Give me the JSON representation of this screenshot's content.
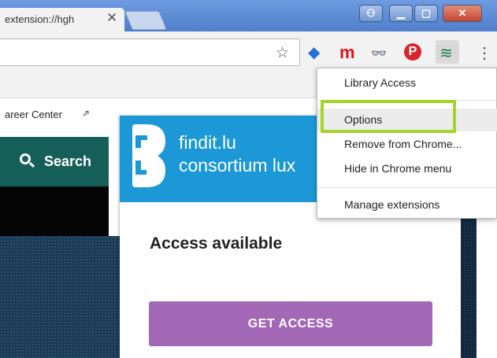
{
  "tab": {
    "title": "extension://hgh",
    "close": "✕"
  },
  "window_buttons": {
    "user": "⚇",
    "minimize": "▁",
    "maximize": "▢",
    "close": "✕"
  },
  "toolbar": {
    "star": "☆",
    "extensions": {
      "diamond": "◆",
      "m": "m",
      "mask": "👓",
      "pin": "P",
      "layers": "≋"
    },
    "menu": "⋮"
  },
  "page": {
    "career_link": "areer Center",
    "career_ext_icon": "⇗",
    "search_label": "Search"
  },
  "popup": {
    "brand_line1": "findit.lu",
    "brand_line2": "consortium lux",
    "access_heading": "Access available",
    "get_access_button": "GET ACCESS",
    "header_color": "#1c98d6",
    "button_color": "#a267b5"
  },
  "context_menu": {
    "items": [
      "Library Access",
      "Options",
      "Remove from Chrome...",
      "Hide in Chrome menu",
      "Manage extensions"
    ],
    "highlight_color": "#a5d42a"
  }
}
